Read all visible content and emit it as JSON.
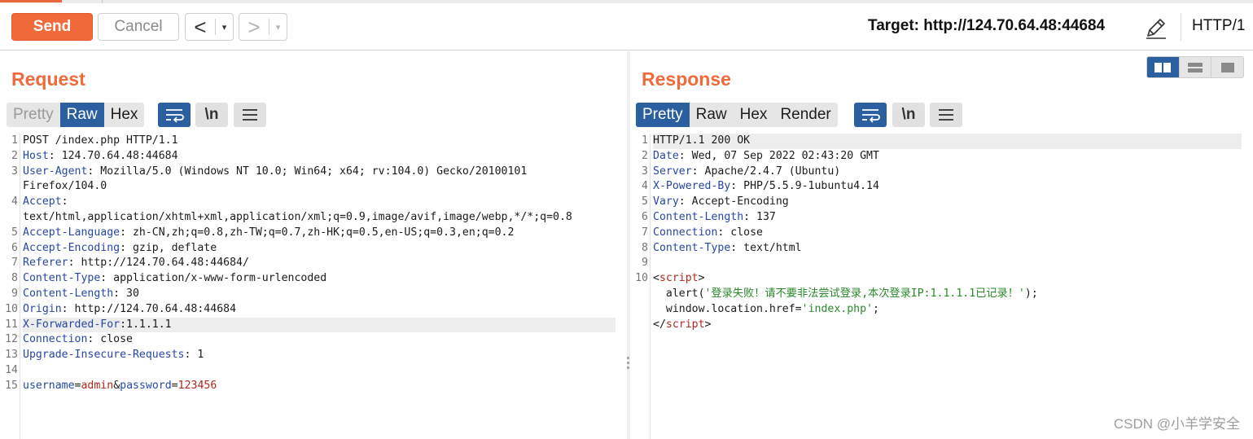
{
  "toolbar": {
    "send_label": "Send",
    "cancel_label": "Cancel",
    "back_glyph": "<",
    "forward_glyph": ">",
    "dropdown_glyph": "▾",
    "target_text": "Target: http://124.70.64.48:44684",
    "edit_icon": "pencil-icon",
    "http_version": "HTTP/1"
  },
  "colors": {
    "accent": "#f06a3a",
    "active_tab": "#2b5fa0",
    "header_key": "#2747a5",
    "param_value": "#b3261e",
    "string": "#2a8a2a"
  },
  "request": {
    "title": "Request",
    "tabs": [
      "Pretty",
      "Raw",
      "Hex"
    ],
    "active_tab": "Raw",
    "newline_button": "\\n",
    "lines": [
      {
        "n": "1",
        "type": "plain",
        "text": "POST /index.php HTTP/1.1"
      },
      {
        "n": "2",
        "type": "header",
        "key": "Host",
        "value": ": 124.70.64.48:44684"
      },
      {
        "n": "3",
        "type": "header",
        "key": "User-Agent",
        "value": ": Mozilla/5.0 (Windows NT 10.0; Win64; x64; rv:104.0) Gecko/20100101"
      },
      {
        "n": "",
        "type": "plain",
        "text": "Firefox/104.0"
      },
      {
        "n": "4",
        "type": "header",
        "key": "Accept",
        "value": ":"
      },
      {
        "n": "",
        "type": "plain",
        "text": "text/html,application/xhtml+xml,application/xml;q=0.9,image/avif,image/webp,*/*;q=0.8"
      },
      {
        "n": "5",
        "type": "header",
        "key": "Accept-Language",
        "value": ": zh-CN,zh;q=0.8,zh-TW;q=0.7,zh-HK;q=0.5,en-US;q=0.3,en;q=0.2"
      },
      {
        "n": "6",
        "type": "header",
        "key": "Accept-Encoding",
        "value": ": gzip, deflate"
      },
      {
        "n": "7",
        "type": "header",
        "key": "Referer",
        "value": ": http://124.70.64.48:44684/"
      },
      {
        "n": "8",
        "type": "header",
        "key": "Content-Type",
        "value": ": application/x-www-form-urlencoded"
      },
      {
        "n": "9",
        "type": "header",
        "key": "Content-Length",
        "value": ": 30"
      },
      {
        "n": "10",
        "type": "header",
        "key": "Origin",
        "value": ": http://124.70.64.48:44684"
      },
      {
        "n": "11",
        "type": "header",
        "key": "X-Forwarded-For",
        "value": ":1.1.1.1",
        "highlight": true
      },
      {
        "n": "12",
        "type": "header",
        "key": "Connection",
        "value": ": close"
      },
      {
        "n": "13",
        "type": "header",
        "key": "Upgrade-Insecure-Requests",
        "value": ": 1"
      },
      {
        "n": "14",
        "type": "plain",
        "text": ""
      },
      {
        "n": "15",
        "type": "params",
        "parts": [
          {
            "t": "username",
            "c": "k"
          },
          {
            "t": "=",
            "c": ""
          },
          {
            "t": "admin",
            "c": "red"
          },
          {
            "t": "&",
            "c": ""
          },
          {
            "t": "password",
            "c": "k"
          },
          {
            "t": "=",
            "c": ""
          },
          {
            "t": "123456",
            "c": "red"
          }
        ]
      }
    ]
  },
  "response": {
    "title": "Response",
    "tabs": [
      "Pretty",
      "Raw",
      "Hex",
      "Render"
    ],
    "active_tab": "Pretty",
    "newline_button": "\\n",
    "lines": [
      {
        "n": "1",
        "type": "plain",
        "text": "HTTP/1.1 200 OK",
        "highlight": true
      },
      {
        "n": "2",
        "type": "header",
        "key": "Date",
        "value": ": Wed, 07 Sep 2022 02:43:20 GMT"
      },
      {
        "n": "3",
        "type": "header",
        "key": "Server",
        "value": ": Apache/2.4.7 (Ubuntu)"
      },
      {
        "n": "4",
        "type": "header",
        "key": "X-Powered-By",
        "value": ": PHP/5.5.9-1ubuntu4.14"
      },
      {
        "n": "5",
        "type": "header",
        "key": "Vary",
        "value": ": Accept-Encoding"
      },
      {
        "n": "6",
        "type": "header",
        "key": "Content-Length",
        "value": ": 137"
      },
      {
        "n": "7",
        "type": "header",
        "key": "Connection",
        "value": ": close"
      },
      {
        "n": "8",
        "type": "header",
        "key": "Content-Type",
        "value": ": text/html"
      },
      {
        "n": "9",
        "type": "plain",
        "text": ""
      },
      {
        "n": "10",
        "type": "parts",
        "parts": [
          {
            "t": "<",
            "c": ""
          },
          {
            "t": "script",
            "c": "red"
          },
          {
            "t": ">",
            "c": ""
          }
        ]
      },
      {
        "n": "",
        "type": "parts",
        "parts": [
          {
            "t": "  alert(",
            "c": ""
          },
          {
            "t": "'登录失败！请不要非法尝试登录,本次登录IP:1.1.1.1已记录！'",
            "c": "green"
          },
          {
            "t": ");",
            "c": ""
          }
        ]
      },
      {
        "n": "",
        "type": "parts",
        "parts": [
          {
            "t": "  window.location.href=",
            "c": ""
          },
          {
            "t": "'index.php'",
            "c": "green"
          },
          {
            "t": ";",
            "c": ""
          }
        ]
      },
      {
        "n": "",
        "type": "parts",
        "parts": [
          {
            "t": "</",
            "c": ""
          },
          {
            "t": "script",
            "c": "red"
          },
          {
            "t": ">",
            "c": ""
          }
        ]
      }
    ]
  },
  "layout_buttons": [
    "split-columns-icon",
    "split-rows-icon",
    "single-pane-icon"
  ],
  "watermark": "CSDN @小羊学安全"
}
